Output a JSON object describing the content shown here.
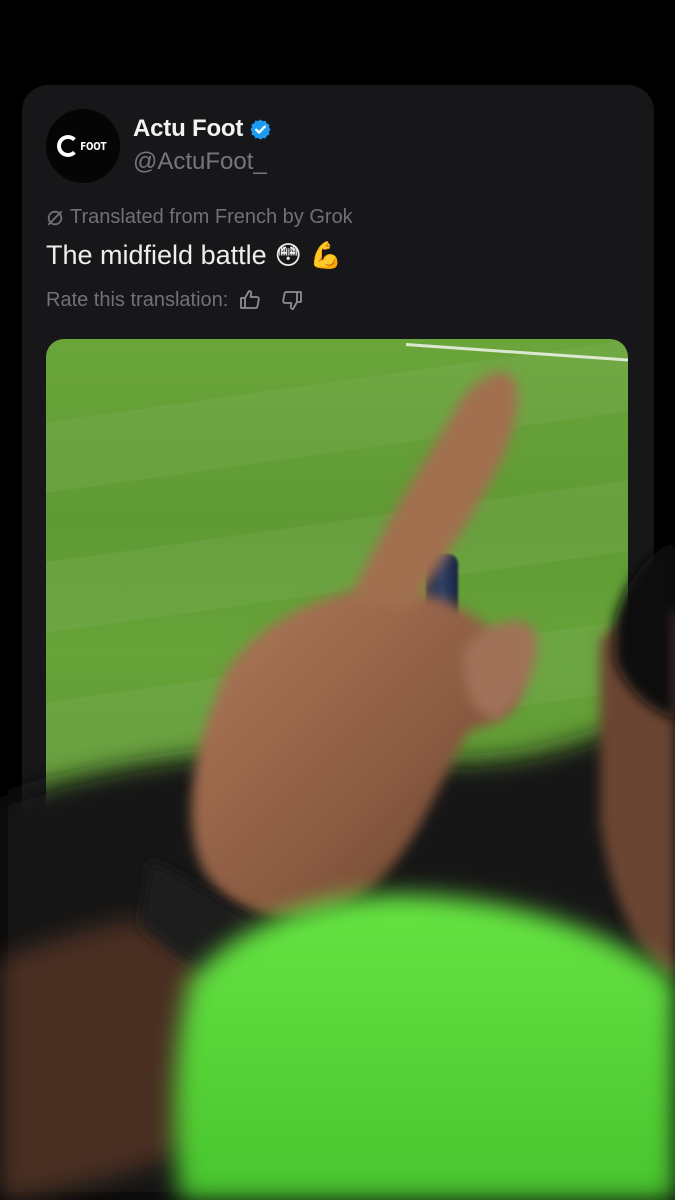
{
  "post": {
    "display_name": "Actu Foot",
    "handle": "@ActuFoot_",
    "avatar_logo_text": "FOOT",
    "translated_label": "Translated from French by Grok",
    "text": "The midfield battle",
    "emojis": [
      "😳",
      "💪"
    ],
    "rate_label": "Rate this translation:"
  },
  "icons": {
    "verified": "verified-badge-icon",
    "grok": "grok-icon",
    "thumbs_up": "thumbs-up-icon",
    "thumbs_down": "thumbs-down-icon"
  },
  "colors": {
    "background": "#000000",
    "card": "#17171a",
    "verified_blue": "#1d9bf0",
    "muted_text": "#6e7278",
    "pitch_green": "#62a036",
    "shirt_green": "#5ee63c"
  }
}
